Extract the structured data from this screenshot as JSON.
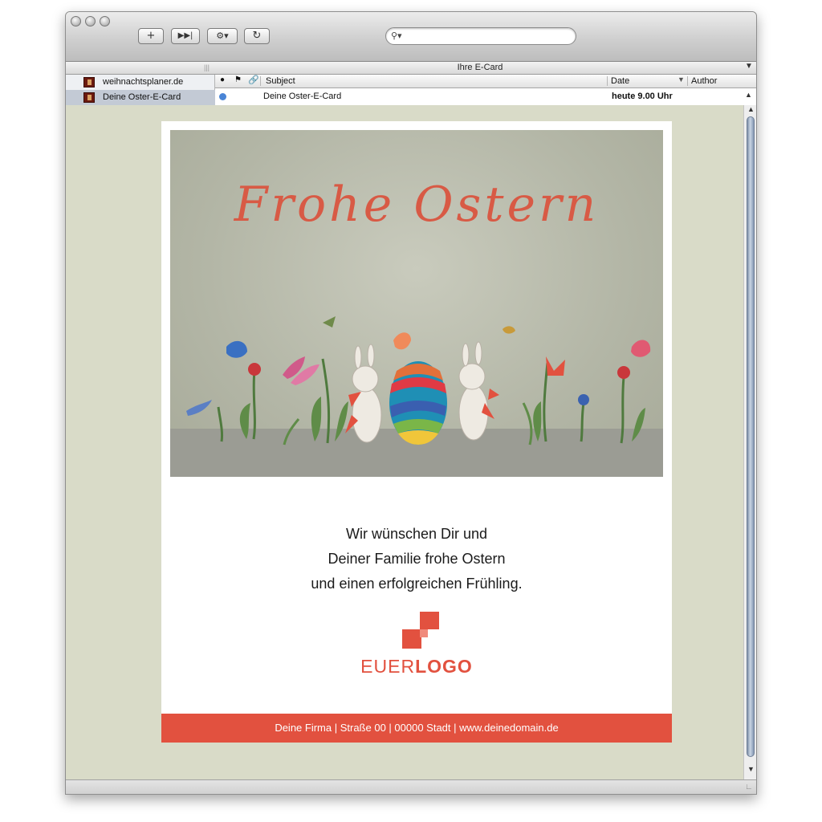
{
  "window": {
    "toolbar": {
      "add_icon": "plus-icon",
      "forward_icon": "skip-forward-icon",
      "action_icon": "gear-menu-icon",
      "refresh_icon": "refresh-icon",
      "search_placeholder": ""
    },
    "column_bar_title": "Ihre E-Card"
  },
  "sidebar": {
    "items": [
      {
        "label": "weihnachtsplaner.de",
        "selected": false
      },
      {
        "label": "Deine Oster-E-Card",
        "selected": true
      }
    ]
  },
  "message_list": {
    "columns": {
      "subject": "Subject",
      "date": "Date",
      "author": "Author"
    },
    "rows": [
      {
        "subject": "Deine Oster-E-Card",
        "date": "heute 9.00 Uhr",
        "author": ""
      }
    ]
  },
  "email": {
    "hero_title": "Frohe Ostern",
    "greeting_lines": [
      "Wir wünschen Dir und",
      "Deiner Familie frohe Ostern",
      "und einen erfolgreichen Frühling."
    ],
    "logo": {
      "text_light": "EUER",
      "text_bold": "LOGO",
      "color": "#e2513f"
    },
    "footer": "Deine Firma | Straße 00 | 00000 Stadt | www.deinedomain.de"
  },
  "colors": {
    "accent": "#e2513f",
    "card_background": "#ffffff",
    "window_background": "#d9dbc8",
    "selection": "#c3cad5"
  }
}
